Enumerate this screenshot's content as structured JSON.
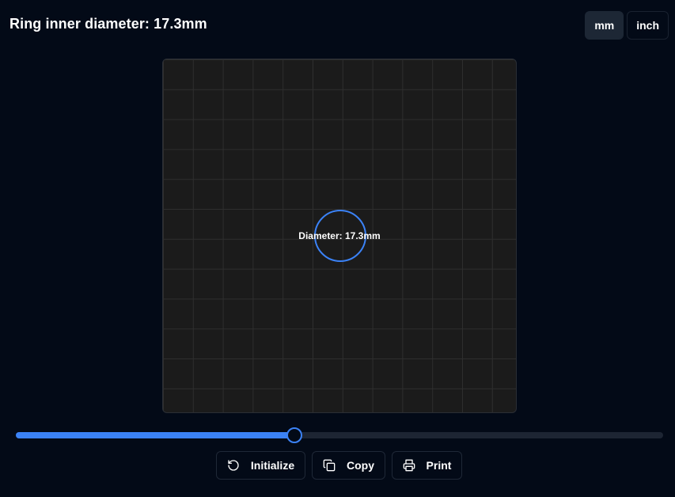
{
  "header": {
    "title": "Ring inner diameter: 17.3mm"
  },
  "units": {
    "options": [
      "mm",
      "inch"
    ],
    "selected": "mm"
  },
  "canvas": {
    "ring_label": "Diameter: 17.3mm",
    "ring_diameter_mm": 17.3
  },
  "slider": {
    "value_fraction": 0.43
  },
  "actions": {
    "initialize": {
      "label": "Initialize",
      "icon": "rotate-ccw-icon"
    },
    "copy": {
      "label": "Copy",
      "icon": "copy-icon"
    },
    "print": {
      "label": "Print",
      "icon": "printer-icon"
    }
  },
  "colors": {
    "accent": "#3b82f6",
    "background": "#030a17",
    "canvas": "#1b1b1b"
  }
}
